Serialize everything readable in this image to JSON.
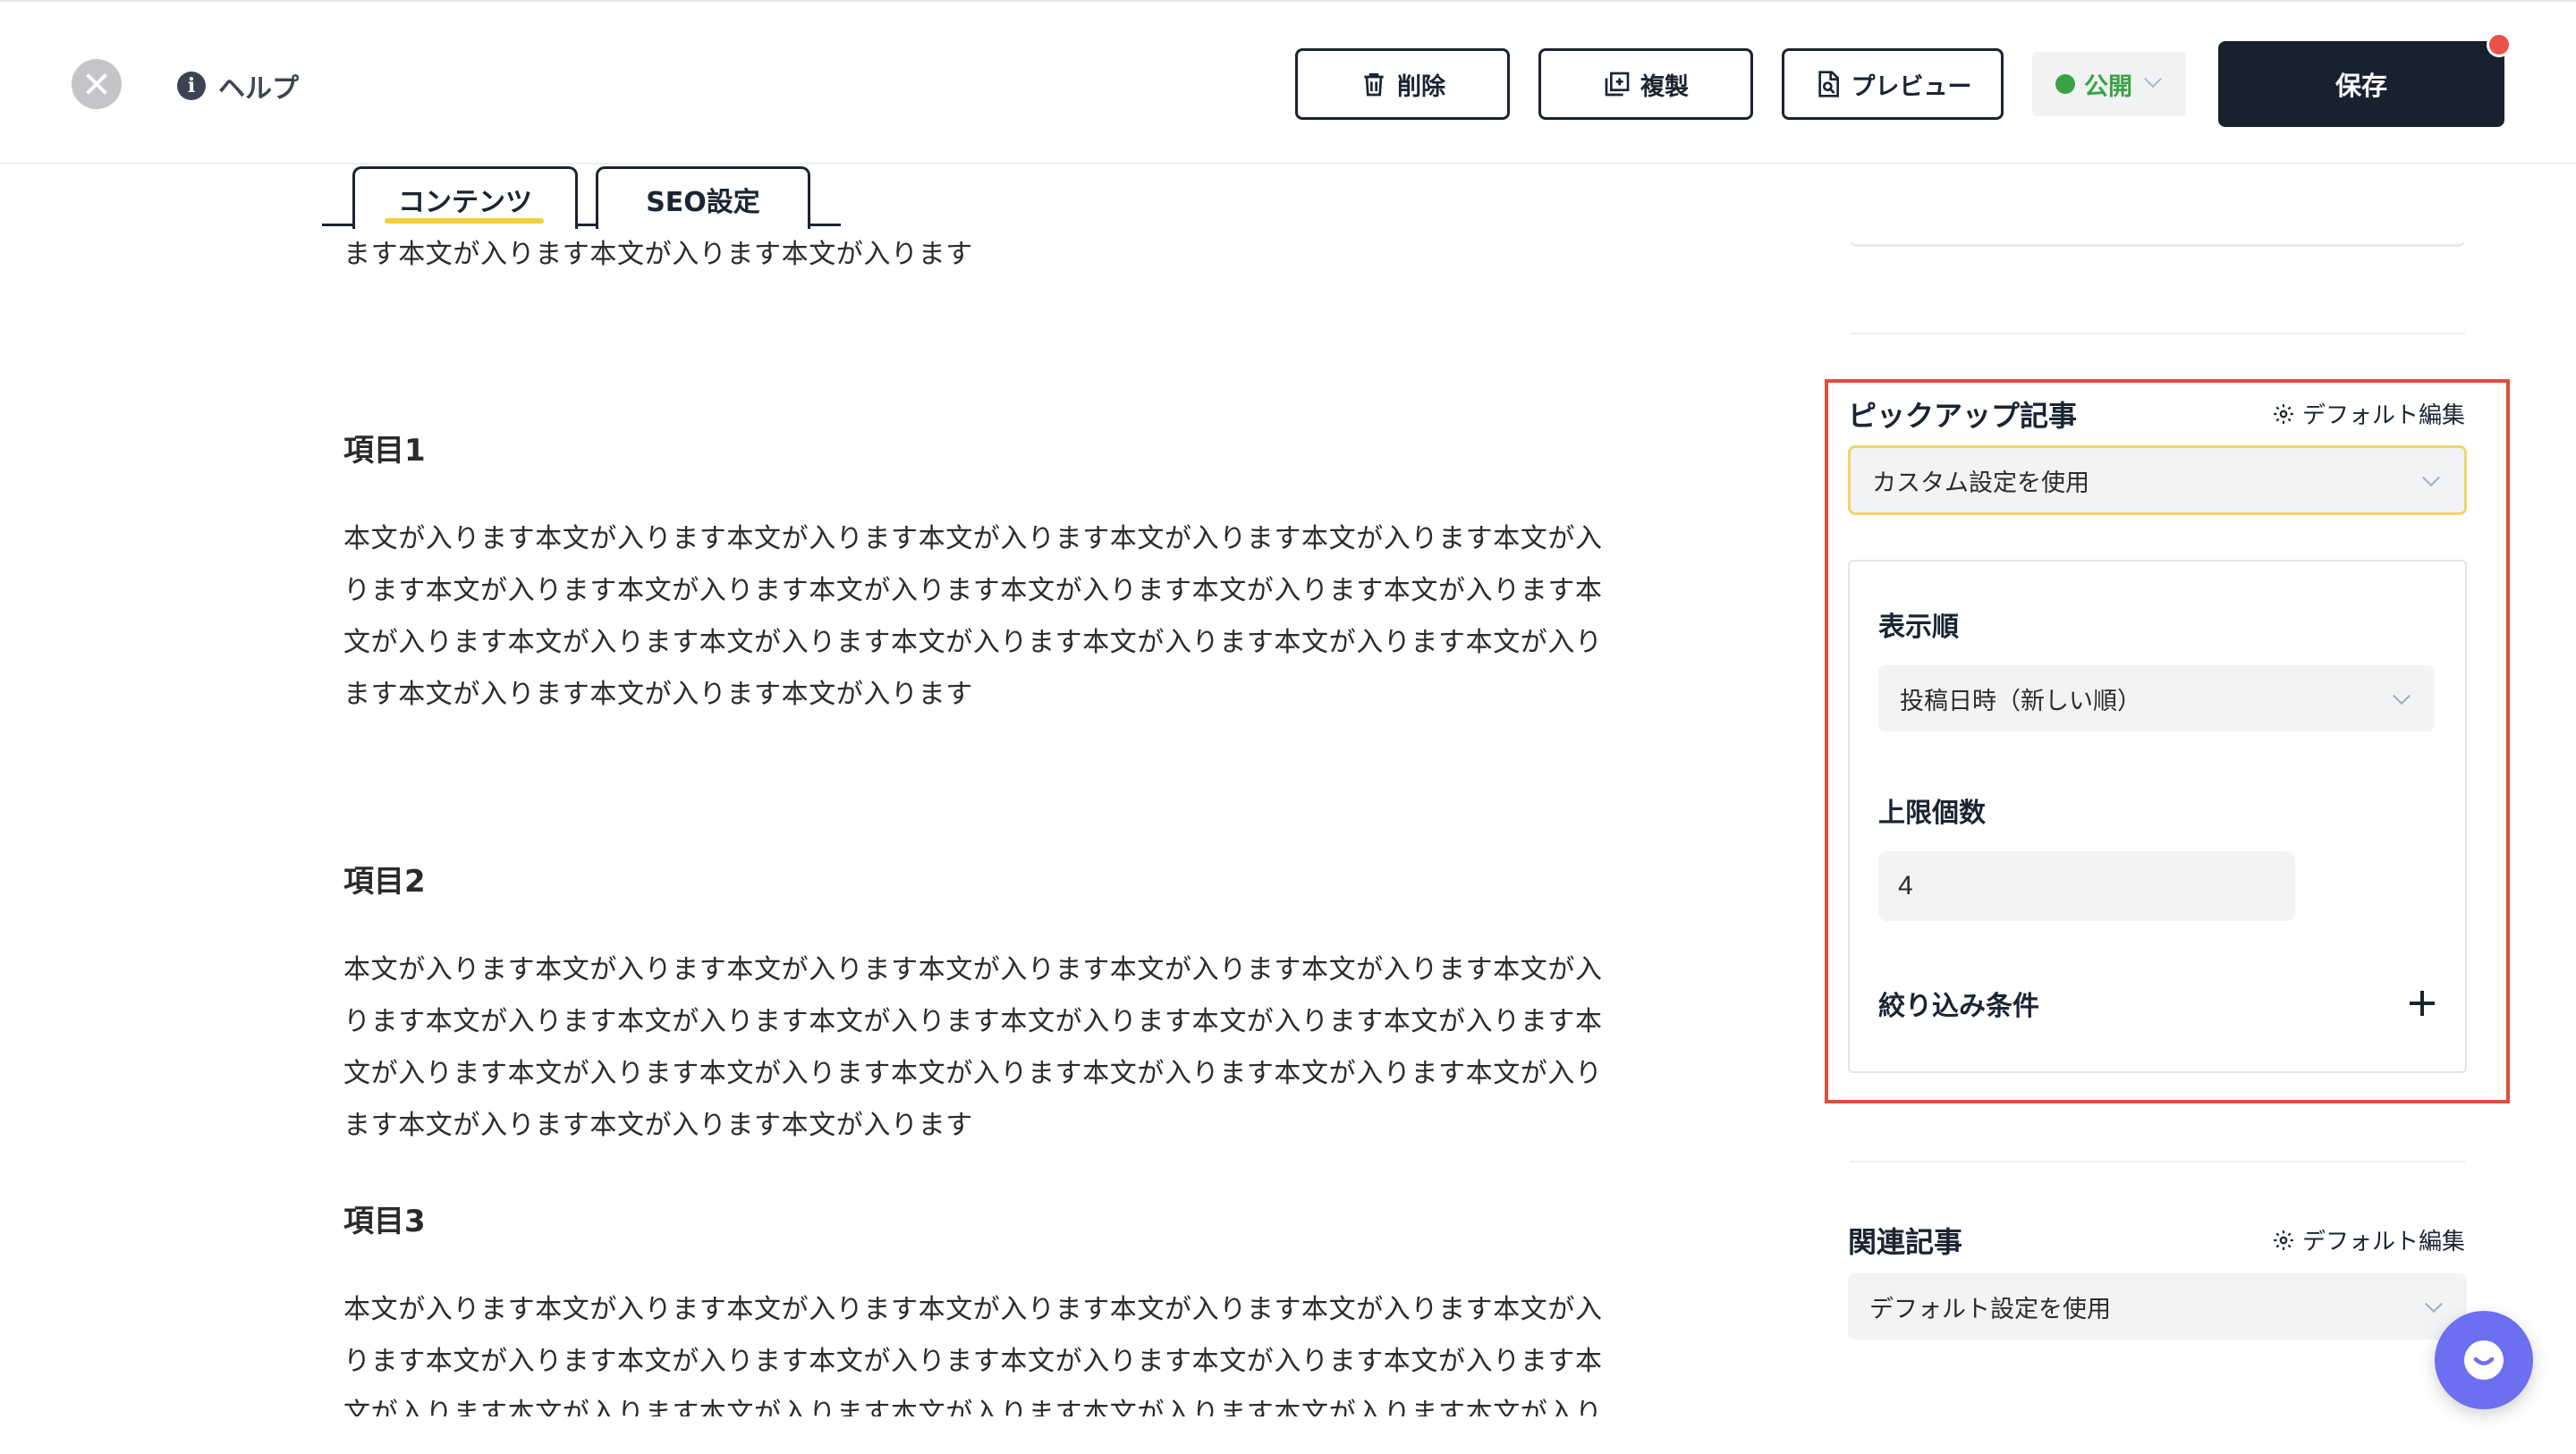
{
  "header": {
    "help_label": "ヘルプ",
    "delete_label": "削除",
    "duplicate_label": "複製",
    "preview_label": "プレビュー",
    "status_label": "公開",
    "save_label": "保存",
    "colors": {
      "primary": "#18222f",
      "status_green": "#3aa343",
      "notification": "#e9524a",
      "highlight": "#e04d3a",
      "tab_accent": "#f2cf3a"
    }
  },
  "tabs": [
    {
      "label": "コンテンツ",
      "active": true
    },
    {
      "label": "SEO設定",
      "active": false
    }
  ],
  "article": {
    "intro_tail": "ます本文が入ります本文が入ります本文が入ります",
    "sections": [
      {
        "heading": "項目1",
        "lines": [
          "本文が入ります本文が入ります本文が入ります本文が入ります本文が入ります本文が入ります本文が入",
          "ります本文が入ります本文が入ります本文が入ります本文が入ります本文が入ります本文が入ります本",
          "文が入ります本文が入ります本文が入ります本文が入ります本文が入ります本文が入ります本文が入り",
          "ます本文が入ります本文が入ります本文が入ります"
        ]
      },
      {
        "heading": "項目2",
        "lines": [
          "本文が入ります本文が入ります本文が入ります本文が入ります本文が入ります本文が入ります本文が入",
          "ります本文が入ります本文が入ります本文が入ります本文が入ります本文が入ります本文が入ります本",
          "文が入ります本文が入ります本文が入ります本文が入ります本文が入ります本文が入ります本文が入り",
          "ます本文が入ります本文が入ります本文が入ります"
        ]
      },
      {
        "heading": "項目3",
        "lines": [
          "本文が入ります本文が入ります本文が入ります本文が入ります本文が入ります本文が入ります本文が入",
          "ります本文が入ります本文が入ります本文が入ります本文が入ります本文が入ります本文が入ります本",
          "文が入ります本文が入ります本文が入ります本文が入ります本文が入ります本文が入ります本文が入り"
        ]
      }
    ]
  },
  "sidebar": {
    "pickup": {
      "title": "ピックアップ記事",
      "default_edit": "デフォルト編集",
      "select_value": "カスタム設定を使用",
      "order_label": "表示順",
      "order_value": "投稿日時（新しい順）",
      "limit_label": "上限個数",
      "limit_value": "4",
      "filter_label": "絞り込み条件"
    },
    "related": {
      "title": "関連記事",
      "default_edit": "デフォルト編集",
      "select_value": "デフォルト設定を使用"
    }
  },
  "icons": [
    "close-icon",
    "info-icon",
    "trash-icon",
    "duplicate-icon",
    "preview-document-icon",
    "chevron-down-icon",
    "gear-icon",
    "plus-icon",
    "chat-icon"
  ]
}
